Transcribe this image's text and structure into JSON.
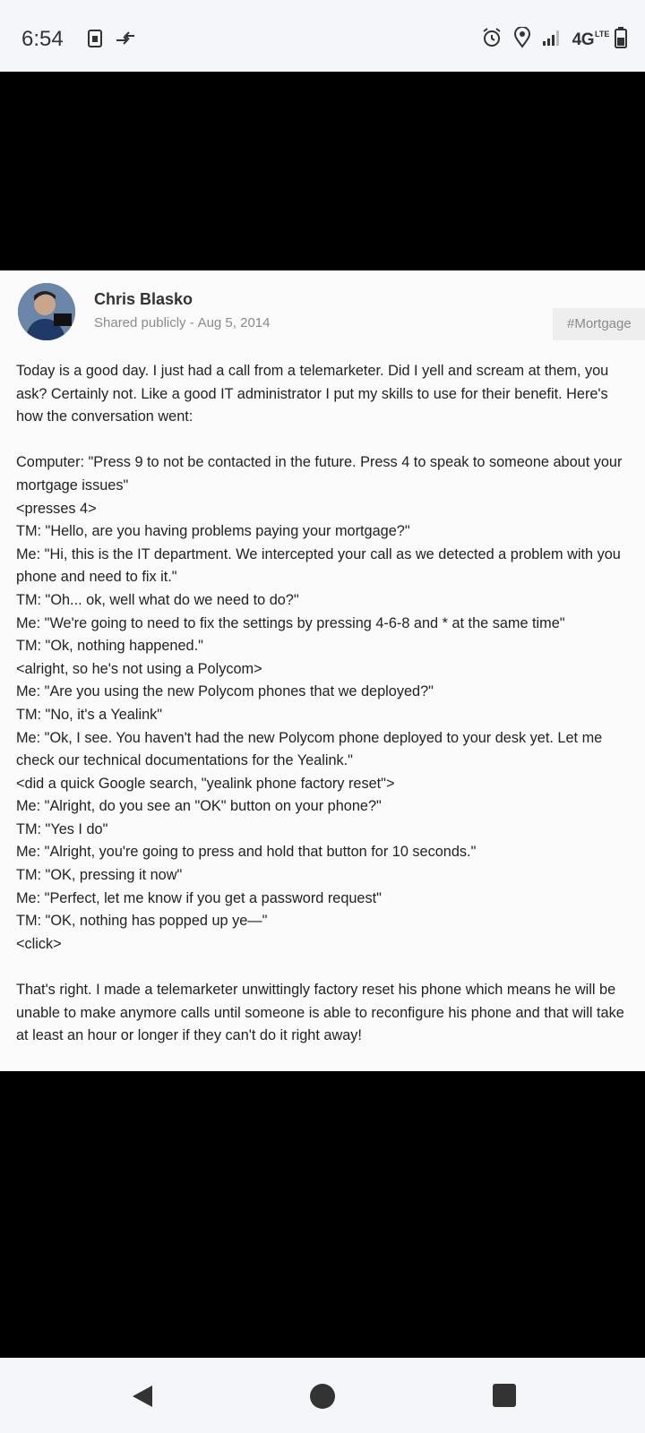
{
  "status_bar": {
    "time": "6:54",
    "network": "4G",
    "network_sub": "LTE",
    "left_icons": [
      "sim-card-icon",
      "data-transfer-icon"
    ],
    "right_icons": [
      "alarm-icon",
      "location-pin-icon",
      "signal-icon",
      "battery-icon"
    ]
  },
  "post": {
    "author": "Chris Blasko",
    "visibility": "Shared publicly",
    "separator": "-",
    "date": "Aug 5, 2014",
    "hashtag": "#Mortgage",
    "intro": "Today is a good day. I just had a call from a telemarketer. Did I yell and scream at them, you ask? Certainly not. Like a good IT administrator I put my skills to use for their benefit. Here's how the conversation went:",
    "conversation": [
      "Computer: \"Press 9 to not be contacted in the future. Press 4 to speak to someone about your mortgage issues\"",
      "<presses 4>",
      "TM: \"Hello, are you having problems paying your mortgage?\"",
      "Me: \"Hi, this is the IT department. We intercepted your call as we detected a problem with you phone and need to fix it.\"",
      "TM: \"Oh... ok, well what do we need to do?\"",
      "Me: \"We're going to need to fix the settings by pressing 4-6-8 and * at the same time\"",
      "TM: \"Ok, nothing happened.\"",
      "<alright, so he's not using a Polycom>",
      "Me: \"Are you using the new Polycom phones that we deployed?\"",
      "TM: \"No, it's a Yealink\"",
      "Me: \"Ok, I see. You haven't had the new Polycom phone deployed to your desk yet. Let me check our technical documentations for the Yealink.\"",
      "<did a quick Google search, \"yealink phone factory reset\">",
      "Me: \"Alright, do you see an \"OK\" button on your phone?\"",
      "TM: \"Yes I do\"",
      "Me: \"Alright, you're going to press and hold that button for 10 seconds.\"",
      "TM: \"OK, pressing it now\"",
      "Me: \"Perfect, let me know if you get a password request\"",
      "TM: \"OK, nothing has popped up ye—\"",
      "<click>"
    ],
    "outro": "That's right. I made a telemarketer unwittingly factory reset his phone which means he will be unable to make anymore calls until someone is able to reconfigure his phone and that will take at least an hour or longer if they can't do it right away!"
  },
  "nav_bar": {
    "buttons": [
      "back-icon",
      "home-icon",
      "recents-icon"
    ]
  }
}
